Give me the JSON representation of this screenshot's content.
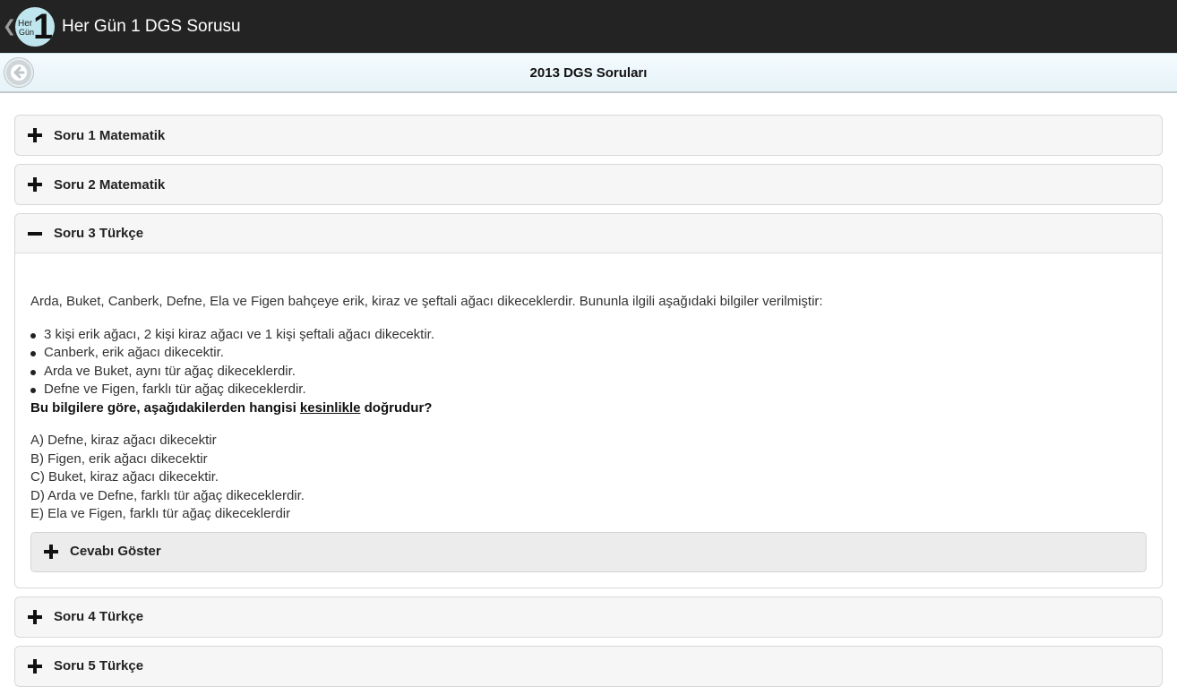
{
  "actionbar": {
    "up_glyph": "❮",
    "logo": {
      "line1": "Her",
      "line2": "Gün",
      "number": "1"
    },
    "title": "Her Gün 1 DGS Sorusu"
  },
  "header": {
    "title": "2013 DGS Soruları",
    "back_icon": "arrow-left-circle-icon"
  },
  "questions": [
    {
      "label": "Soru 1 Matematik",
      "state": "collapsed"
    },
    {
      "label": "Soru 2 Matematik",
      "state": "collapsed"
    },
    {
      "label": "Soru 3 Türkçe",
      "state": "expanded",
      "intro": "Arda, Buket, Canberk, Defne, Ela ve Figen bahçeye erik, kiraz ve şeftali ağacı dikeceklerdir. Bununla ilgili aşağıdaki bilgiler verilmiştir:",
      "facts": [
        "3 kişi erik ağacı, 2 kişi kiraz ağacı ve 1 kişi şeftali ağacı dikecektir.",
        "Canberk, erik ağacı dikecektir.",
        "Arda ve Buket, aynı tür ağaç dikeceklerdir.",
        "Defne ve Figen, farklı tür ağaç dikeceklerdir."
      ],
      "question_pre": "Bu bilgilere göre, aşağıdakilerden hangisi ",
      "question_emph": "kesinlikle",
      "question_post": " doğrudur?",
      "options": [
        "A) Defne, kiraz ağacı dikecektir",
        "B) Figen, erik ağacı dikecektir",
        "C) Buket, kiraz ağacı dikecektir.",
        "D) Arda ve Defne, farklı tür ağaç dikeceklerdir.",
        "E) Ela ve Figen, farklı tür ağaç dikeceklerdir"
      ],
      "answer_label": "Cevabı Göster"
    },
    {
      "label": "Soru 4 Türkçe",
      "state": "collapsed"
    },
    {
      "label": "Soru 5 Türkçe",
      "state": "collapsed"
    }
  ],
  "colors": {
    "actionbar": "#232323",
    "header_bg": "#eaf6fb",
    "item_bg": "#f6f6f6"
  }
}
